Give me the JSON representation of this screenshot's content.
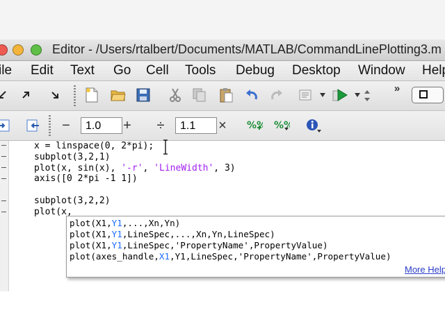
{
  "window": {
    "title": "Editor - /Users/rtalbert/Documents/MATLAB/CommandLinePlotting3.m",
    "colors": {
      "close": "#ee5b52",
      "minimize": "#f2b43a",
      "zoom": "#5fbf46"
    }
  },
  "menubar": {
    "items": [
      "ile",
      "Edit",
      "Text",
      "Go",
      "Cell",
      "Tools",
      "Debug",
      "Desktop",
      "Window",
      "Help"
    ]
  },
  "toolbar": {
    "icons": [
      "arrow-left-icon",
      "arrow-up-right-icon",
      "arrow-down-right-icon",
      "new-file-icon",
      "open-folder-icon",
      "save-icon",
      "cut-icon",
      "copy-icon",
      "paste-icon",
      "undo-icon",
      "redo-icon",
      "document-icon",
      "run-icon",
      "step-icon",
      "overflow-icon",
      "panel-icon"
    ]
  },
  "cell_toolbar": {
    "minus": "−",
    "value1": "1.0",
    "plus": "+",
    "divide": "÷",
    "value2": "1.1",
    "times": "×"
  },
  "editor": {
    "lines": [
      {
        "parts": [
          {
            "t": "x = linspace(0, 2*pi);",
            "s": ""
          }
        ]
      },
      {
        "parts": [
          {
            "t": "subplot(3,2,1)",
            "s": ""
          }
        ]
      },
      {
        "parts": [
          {
            "t": "plot(x, sin(x), ",
            "s": ""
          },
          {
            "t": "'-r'",
            "s": "str"
          },
          {
            "t": ", ",
            "s": ""
          },
          {
            "t": "'LineWidth'",
            "s": "str"
          },
          {
            "t": ", 3)",
            "s": ""
          }
        ]
      },
      {
        "parts": [
          {
            "t": "axis([0 2*pi -1 1])",
            "s": ""
          }
        ]
      },
      {
        "parts": [
          {
            "t": "",
            "s": ""
          }
        ]
      },
      {
        "parts": [
          {
            "t": "subplot(3,2,2)",
            "s": ""
          }
        ]
      },
      {
        "parts": [
          {
            "t": "plot(x,",
            "s": ""
          }
        ]
      }
    ]
  },
  "autocomplete": {
    "suggestions": [
      [
        {
          "t": "plot(X1,",
          "s": ""
        },
        {
          "t": "Y1",
          "s": "hl"
        },
        {
          "t": ",...,Xn,Yn)",
          "s": ""
        }
      ],
      [
        {
          "t": "plot(X1,",
          "s": ""
        },
        {
          "t": "Y1",
          "s": "hl"
        },
        {
          "t": ",LineSpec,...,Xn,Yn,LineSpec)",
          "s": ""
        }
      ],
      [
        {
          "t": "plot(X1,",
          "s": ""
        },
        {
          "t": "Y1",
          "s": "hl"
        },
        {
          "t": ",LineSpec,'PropertyName',PropertyValue)",
          "s": ""
        }
      ],
      [
        {
          "t": "plot(axes_handle,",
          "s": ""
        },
        {
          "t": "X1",
          "s": "hl"
        },
        {
          "t": ",Y1,LineSpec,'PropertyName',PropertyValue)",
          "s": ""
        }
      ]
    ],
    "more_help": "More Help..."
  }
}
